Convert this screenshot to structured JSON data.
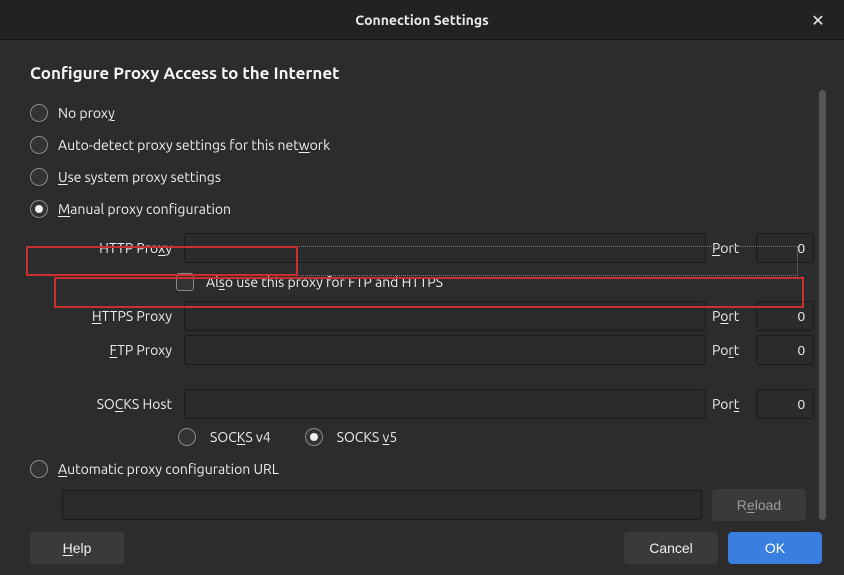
{
  "window": {
    "title": "Connection Settings"
  },
  "heading": "Configure Proxy Access to the Internet",
  "proxy_mode": {
    "no_proxy": {
      "pre": "No prox",
      "u": "y",
      "post": ""
    },
    "auto_detect": {
      "pre": "Auto-detect proxy settings for this net",
      "u": "w",
      "post": "ork"
    },
    "system": {
      "pre": "",
      "u": "U",
      "post": "se system proxy settings"
    },
    "manual": {
      "pre": "",
      "u": "M",
      "post": "anual proxy configuration"
    },
    "auto_url": {
      "pre": "",
      "u": "A",
      "post": "utomatic proxy configuration URL"
    }
  },
  "fields": {
    "http": {
      "label_pre": "HTTP Pro",
      "label_u": "x",
      "label_post": "y",
      "value": "",
      "port_pre": "",
      "port_u": "P",
      "port_post": "ort",
      "port": "0"
    },
    "https": {
      "label_pre": "",
      "label_u": "H",
      "label_post": "TTPS Proxy",
      "value": "",
      "port_pre": "P",
      "port_u": "o",
      "port_post": "rt",
      "port": "0"
    },
    "ftp": {
      "label_pre": "",
      "label_u": "F",
      "label_post": "TP Proxy",
      "value": "",
      "port_pre": "Po",
      "port_u": "r",
      "port_post": "t",
      "port": "0"
    },
    "socks": {
      "label_pre": "SO",
      "label_u": "C",
      "label_post": "KS Host",
      "value": "",
      "port_pre": "Por",
      "port_u": "t",
      "port_post": "",
      "port": "0"
    }
  },
  "also_checkbox": {
    "pre": "Al",
    "u": "s",
    "post": "o use this proxy for FTP and HTTPS"
  },
  "socks_ver": {
    "v4": {
      "pre": "SOC",
      "u": "K",
      "post": "S v4"
    },
    "v5": {
      "pre": "SOCKS ",
      "u": "v",
      "post": "5"
    }
  },
  "auto_url_value": "",
  "buttons": {
    "reload": {
      "pre": "R",
      "u": "e",
      "post": "load"
    },
    "help": {
      "pre": "",
      "u": "H",
      "post": "elp"
    },
    "cancel": "Cancel",
    "ok": "OK"
  }
}
